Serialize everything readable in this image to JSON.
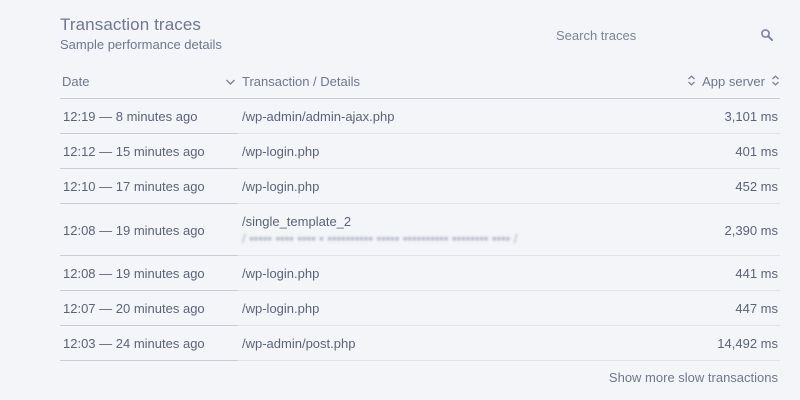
{
  "header": {
    "title": "Transaction traces",
    "subtitle": "Sample performance details"
  },
  "search": {
    "placeholder": "Search traces",
    "icon": "search-icon"
  },
  "table": {
    "columns": {
      "date": "Date",
      "transaction": "Transaction / Details",
      "app_server": "App server"
    },
    "rows": [
      {
        "date": "12:19 — 8 minutes ago",
        "transaction": "/wp-admin/admin-ajax.php",
        "details": "",
        "app_server": "3,101 ms"
      },
      {
        "date": "12:12 — 15 minutes ago",
        "transaction": "/wp-login.php",
        "details": "",
        "app_server": "401 ms"
      },
      {
        "date": "12:10 — 17 minutes ago",
        "transaction": "/wp-login.php",
        "details": "",
        "app_server": "452 ms"
      },
      {
        "date": "12:08 — 19 minutes ago",
        "transaction": "/single_template_2",
        "details": "/ ••••• •••• •••• • •••••••••• ••••• •••••••••• •••••••• •••• / ",
        "app_server": "2,390 ms"
      },
      {
        "date": "12:08 — 19 minutes ago",
        "transaction": "/wp-login.php",
        "details": "",
        "app_server": "441 ms"
      },
      {
        "date": "12:07 — 20 minutes ago",
        "transaction": "/wp-login.php",
        "details": "",
        "app_server": "447 ms"
      },
      {
        "date": "12:03 — 24 minutes ago",
        "transaction": "/wp-admin/post.php",
        "details": "",
        "app_server": "14,492 ms"
      }
    ]
  },
  "footer": {
    "more_link": "Show more slow transactions"
  },
  "colors": {
    "background": "#f4f5f8",
    "text": "#5b6378",
    "muted": "#6e778c",
    "divider": "#c9cdd6"
  }
}
